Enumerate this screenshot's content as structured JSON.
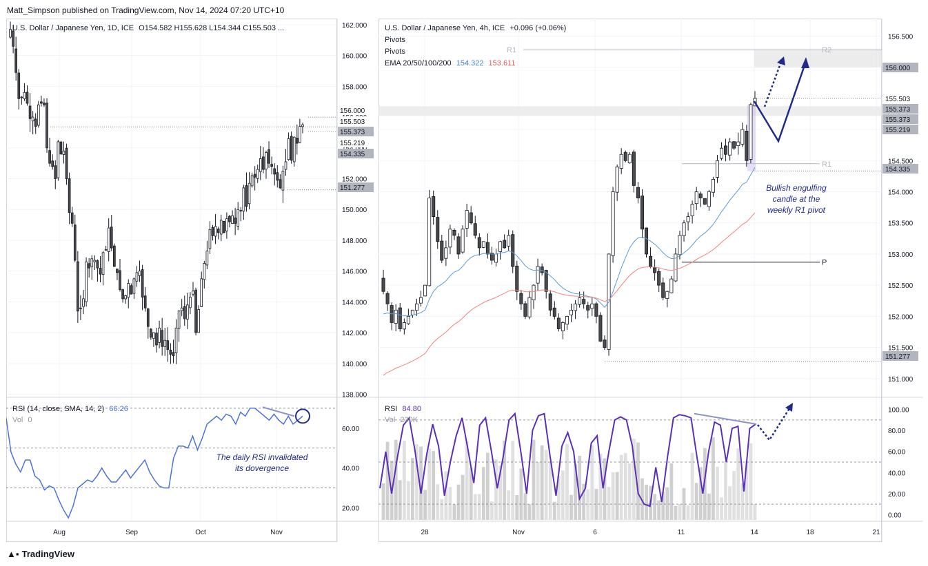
{
  "publisher": "Matt_Simpson published on TradingView.com, Nov 14, 2024 07:20 UTC+10",
  "brand": "TradingView",
  "colors": {
    "up": "#ffffff",
    "down": "#4a4a4a",
    "ema20": "#5b9bd5",
    "ema50": "#f28080",
    "rsi_daily": "#4c72d9",
    "rsi_4h": "#5b2fb5",
    "annotation": "#1f2a8a",
    "grid": "#f0f3fa"
  },
  "daily": {
    "legend": "U.S. Dollar / Japanese Yen, 1D, ICE",
    "ohlc": "O154.582  H155.628  L154.344  C155.503 ...",
    "rsi_legend": "RSI (14, close, SMA, 14, 2)",
    "rsi_value": "66.26",
    "vol_legend": "Vol",
    "vol_value": "0",
    "annotation": [
      "The daily RSI invalidated",
      "its dovergence"
    ]
  },
  "h4": {
    "legend": "U.S. Dollar / Japanese Yen, 4h, ICE",
    "change": "+0.096 (+0.06%)",
    "pivots1": "Pivots",
    "pivots2": "Pivots",
    "ema_legend": "EMA 20/50/100/200",
    "ema_val1": "154.322",
    "ema_val2": "153.611",
    "rsi_legend": "RSI",
    "rsi_value": "84.80",
    "vol_legend": "Vol",
    "vol_value": "230K",
    "annotation": [
      "Bullish engulfing",
      "candle at the",
      "weekly R1 pivot"
    ],
    "pivot_labels": [
      "R1",
      "R2",
      "R1",
      "P"
    ]
  },
  "chart_data": [
    {
      "type": "candlestick",
      "title": "U.S. Dollar / Japanese Yen, 1D, ICE",
      "x_ticks": [
        "Aug",
        "Sep",
        "Oct",
        "Nov"
      ],
      "y_ticks": [
        "138.000",
        "140.000",
        "142.000",
        "144.000",
        "146.000",
        "148.000",
        "150.000",
        "152.000",
        "154.000",
        "156.000",
        "158.000",
        "160.000",
        "162.000"
      ],
      "ylim": [
        137.8,
        162.4
      ],
      "price_labels": [
        {
          "text": "156.000",
          "value": 156.0,
          "highlight": false
        },
        {
          "text": "155.503",
          "value": 155.503,
          "highlight": false
        },
        {
          "text": "155.373",
          "value": 155.373,
          "highlight": true
        },
        {
          "text": "155.219",
          "value": 155.219,
          "highlight": false
        },
        {
          "text": "154.335",
          "value": 154.335,
          "highlight": true
        },
        {
          "text": "151.277",
          "value": 151.277,
          "highlight": true
        }
      ],
      "closes": [
        161.7,
        160.6,
        158.9,
        157.2,
        157.3,
        157.6,
        156.9,
        155.9,
        156.0,
        155.4,
        156.8,
        156.9,
        156.8,
        154.0,
        153.0,
        152.8,
        152.0,
        154.4,
        153.6,
        153.8,
        152.0,
        149.8,
        149.1,
        146.7,
        143.4,
        143.6,
        144.2,
        146.6,
        146.2,
        146.8,
        146.7,
        146.2,
        145.8,
        147.2,
        147.4,
        148.8,
        147.5,
        146.3,
        145.9,
        144.8,
        144.2,
        144.4,
        145.2,
        144.5,
        145.5,
        145.9,
        146.0,
        144.3,
        143.6,
        142.4,
        141.7,
        142.0,
        141.2,
        142.3,
        141.1,
        141.5,
        140.9,
        140.6,
        140.5,
        142.3,
        143.4,
        143.6,
        142.9,
        143.8,
        144.3,
        144.7,
        142.0,
        143.5,
        145.5,
        146.5,
        147.3,
        148.7,
        148.3,
        148.9,
        148.5,
        149.3,
        148.5,
        149.4,
        149.2,
        149.6,
        149.1,
        150.0,
        149.9,
        151.4,
        150.2,
        151.7,
        152.2,
        152.1,
        152.6,
        153.3,
        152.6,
        153.7,
        153.0,
        152.8,
        152.3,
        151.9,
        151.4,
        152.5,
        153.1,
        154.6,
        153.2,
        154.7,
        154.3,
        155.4,
        155.5
      ],
      "annotations": [
        "The daily RSI invalidated",
        "its dovergence"
      ]
    },
    {
      "type": "line",
      "title": "RSI (14, close, SMA, 14, 2)",
      "y_ticks": [
        "20.00",
        "40.00",
        "60.00"
      ],
      "ylim": [
        14,
        72
      ],
      "values": [
        65,
        48,
        42,
        38,
        44,
        44,
        36,
        34,
        29,
        31,
        30,
        24,
        19,
        15,
        21,
        30,
        32,
        34,
        33,
        36,
        40,
        36,
        33,
        33,
        36,
        39,
        35,
        38,
        41,
        44,
        38,
        34,
        31,
        30,
        30,
        45,
        51,
        51,
        50,
        56,
        49,
        55,
        62,
        64,
        66,
        64,
        67,
        66,
        62,
        68,
        66,
        70,
        70,
        68,
        66,
        64,
        67,
        64,
        62,
        66,
        62,
        64,
        66
      ]
    },
    {
      "type": "candlestick",
      "title": "U.S. Dollar / Japanese Yen, 4h, ICE",
      "x_ticks": [
        "28",
        "Nov",
        "6",
        "11",
        "14",
        "18",
        "21"
      ],
      "y_ticks": [
        "151.000",
        "151.500",
        "152.000",
        "152.500",
        "153.000",
        "153.500",
        "154.000",
        "154.500",
        "155.000",
        "155.503",
        "156.000",
        "156.500"
      ],
      "ylim": [
        150.7,
        156.78
      ],
      "price_labels": [
        {
          "text": "156.000",
          "value": 156.0,
          "highlight": true
        },
        {
          "text": "155.503",
          "value": 155.503,
          "highlight": false
        },
        {
          "text": "155.373",
          "value": 155.373,
          "highlight": true
        },
        {
          "text": "155.373",
          "value": 155.215,
          "highlight": true
        },
        {
          "text": "155.219",
          "value": 155.06,
          "highlight": true
        },
        {
          "text": "154.335",
          "value": 154.335,
          "highlight": true
        },
        {
          "text": "151.277",
          "value": 151.277,
          "highlight": true
        }
      ],
      "pivots": [
        {
          "label": "R1",
          "value": 156.28
        },
        {
          "label": "R2",
          "value": 156.28
        },
        {
          "label": "R1",
          "value": 154.45
        },
        {
          "label": "P",
          "value": 152.87
        }
      ],
      "ema_20_last": 154.322,
      "ema_50_last": 153.611,
      "annotations": [
        "Bullish engulfing",
        "candle at the",
        "weekly R1 pivot"
      ]
    },
    {
      "type": "line",
      "title": "RSI",
      "y_ticks": [
        "0.00",
        "20.00",
        "40.00",
        "60.00",
        "80.00",
        "100.00"
      ],
      "ylim": [
        -5,
        105
      ],
      "last_value": 84.8,
      "values": [
        25,
        60,
        20,
        55,
        85,
        92,
        60,
        20,
        58,
        86,
        65,
        18,
        50,
        75,
        92,
        62,
        30,
        85,
        92,
        60,
        25,
        55,
        90,
        96,
        60,
        20,
        80,
        94,
        96,
        55,
        18,
        65,
        78,
        60,
        15,
        25,
        68,
        75,
        25,
        60,
        90,
        93,
        90,
        65,
        20,
        10,
        8,
        45,
        12,
        55,
        92,
        95,
        94,
        92,
        55,
        20,
        60,
        88,
        85,
        50,
        82,
        84,
        22,
        82,
        86
      ]
    }
  ]
}
